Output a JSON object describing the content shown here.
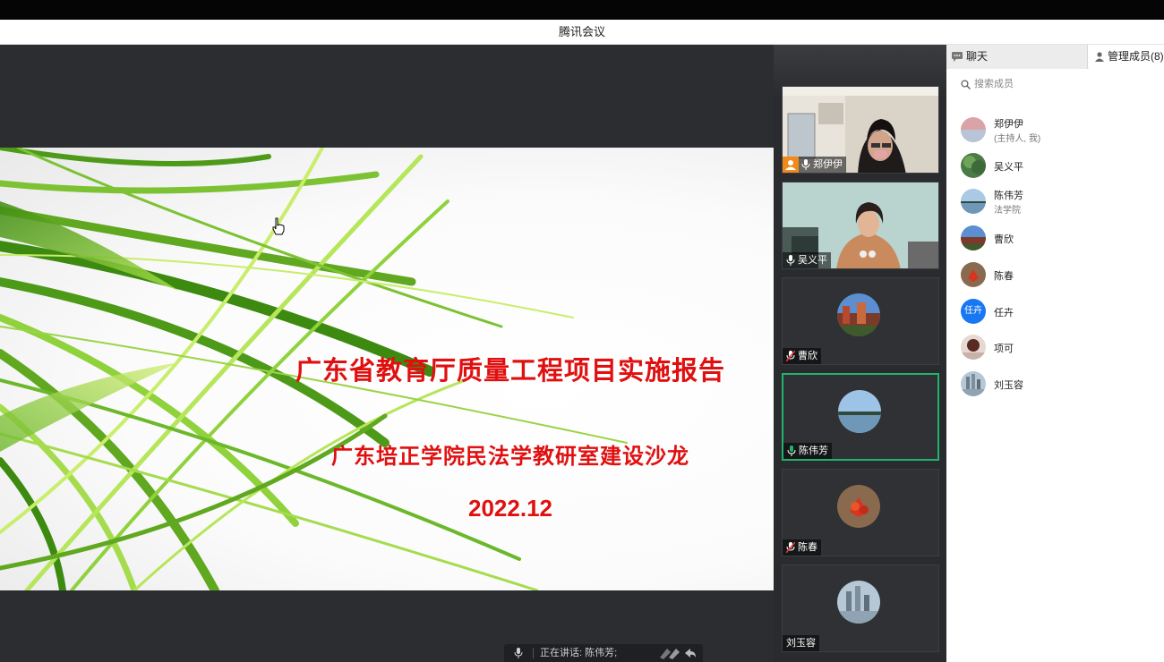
{
  "window": {
    "title": "腾讯会议"
  },
  "slide": {
    "title": "广东省教育厅质量工程项目实施报告",
    "subtitle": "广东培正学院民法学教研室建设沙龙",
    "date": "2022.12"
  },
  "speaking": {
    "text": "正在讲话: 陈伟芳;"
  },
  "videos": [
    {
      "name": "郑伊伊",
      "host": true,
      "kind": "camera"
    },
    {
      "name": "吴义平",
      "host": false,
      "kind": "camera"
    },
    {
      "name": "曹欣",
      "host": false,
      "kind": "avatar",
      "muted": true
    },
    {
      "name": "陈伟芳",
      "host": false,
      "kind": "avatar",
      "speaking": true
    },
    {
      "name": "陈春",
      "host": false,
      "kind": "avatar",
      "muted": true
    },
    {
      "name": "刘玉容",
      "host": false,
      "kind": "avatar"
    }
  ],
  "panel": {
    "tab_chat": "聊天",
    "tab_members": "管理成员(8)",
    "search_placeholder": "搜索成员",
    "members": [
      {
        "name": "郑伊伊",
        "sub": "(主持人, 我)"
      },
      {
        "name": "吴义平",
        "sub": ""
      },
      {
        "name": "陈伟芳",
        "sub": "法学院"
      },
      {
        "name": "曹欣",
        "sub": ""
      },
      {
        "name": "陈春",
        "sub": ""
      },
      {
        "name": "任卉",
        "sub": "",
        "avatar_text": "任卉"
      },
      {
        "name": "项可",
        "sub": ""
      },
      {
        "name": "刘玉容",
        "sub": ""
      }
    ]
  },
  "colors": {
    "accent_green": "#1fb46b",
    "slide_red": "#e01010",
    "host_orange": "#f08a1a"
  }
}
